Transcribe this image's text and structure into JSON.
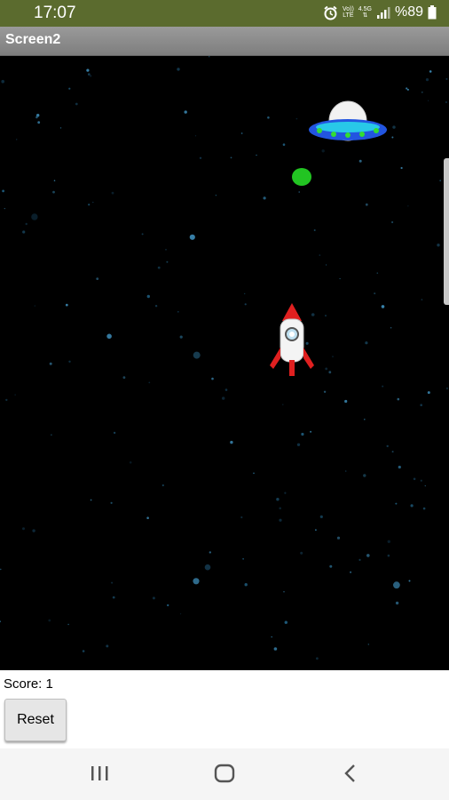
{
  "status_bar": {
    "time": "17:07",
    "signal_top": "Vo))",
    "signal_bottom": "LTE",
    "network_top": "4.5G",
    "battery_text": "%89",
    "battery_level": 0.89
  },
  "title_bar": {
    "title": "Screen2"
  },
  "game": {
    "score_text": "Score: 1",
    "reset_label": "Reset"
  },
  "icons": {
    "alarm": "alarm-icon",
    "signal": "signal-bars-icon",
    "battery": "battery-icon",
    "recents": "recents-icon",
    "home": "home-icon",
    "back": "back-icon"
  },
  "colors": {
    "status_bar": "#5b6b2e",
    "title_bar": "#8a8a8a",
    "canvas": "#000000",
    "ball": "#22c422",
    "rocket_red": "#e02020",
    "ufo_blue": "#2255e0"
  }
}
